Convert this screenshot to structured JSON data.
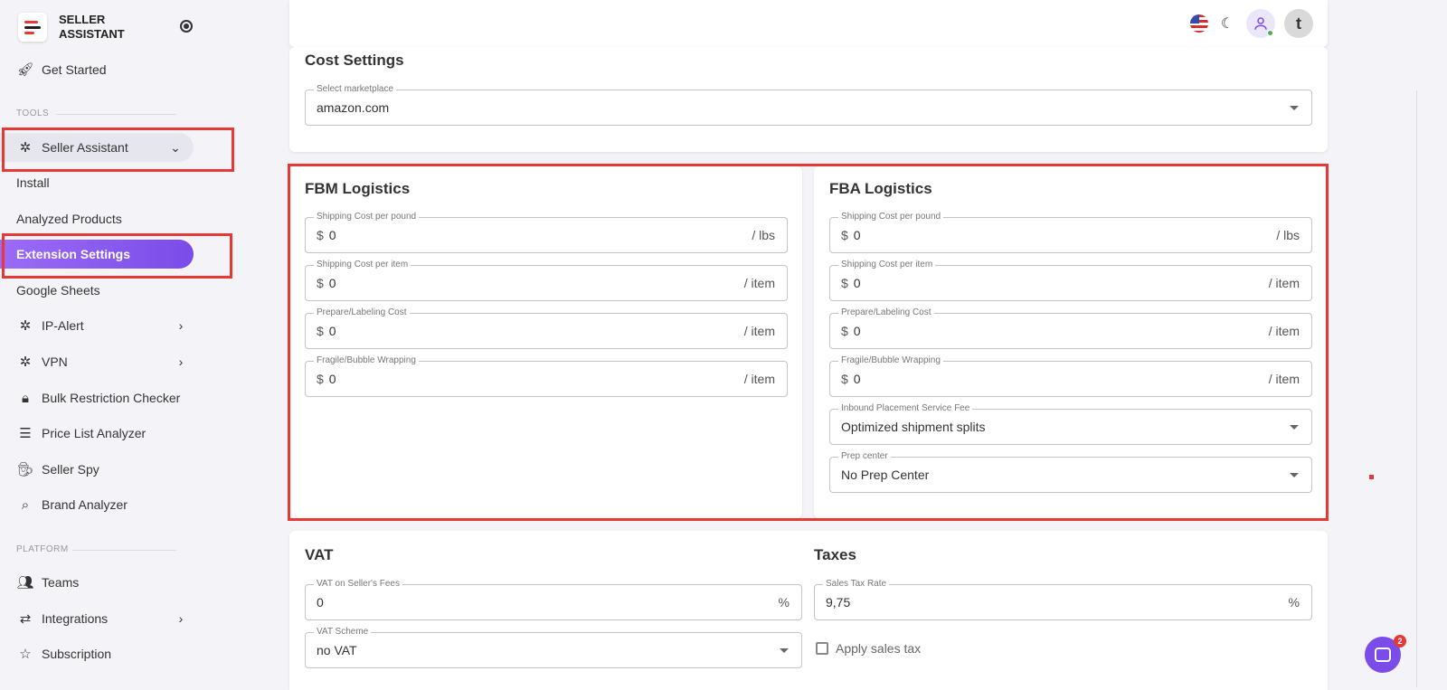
{
  "sidebar": {
    "brand": "SELLER ASSISTANT",
    "get_started": "Get Started",
    "tools_label": "TOOLS",
    "seller_assistant": "Seller Assistant",
    "install": "Install",
    "analyzed_products": "Analyzed Products",
    "extension_settings": "Extension Settings",
    "google_sheets": "Google Sheets",
    "ip_alert": "IP-Alert",
    "vpn": "VPN",
    "bulk_restriction": "Bulk Restriction Checker",
    "price_list": "Price List Analyzer",
    "seller_spy": "Seller Spy",
    "brand_analyzer": "Brand Analyzer",
    "platform_label": "PLATFORM",
    "teams": "Teams",
    "integrations": "Integrations",
    "subscription": "Subscription"
  },
  "topbar": {
    "avatar_letter": "t",
    "icons": [
      "us-flag-icon",
      "moon-icon",
      "user-icon"
    ]
  },
  "cost_settings": {
    "title": "Cost Settings",
    "marketplace_label": "Select marketplace",
    "marketplace_value": "amazon.com"
  },
  "fbm": {
    "title": "FBM Logistics",
    "currency": "$",
    "fields": [
      {
        "label": "Shipping Cost per pound",
        "value": "0",
        "unit": "/ lbs"
      },
      {
        "label": "Shipping Cost per item",
        "value": "0",
        "unit": "/ item"
      },
      {
        "label": "Prepare/Labeling Cost",
        "value": "0",
        "unit": "/ item"
      },
      {
        "label": "Fragile/Bubble Wrapping",
        "value": "0",
        "unit": "/ item"
      }
    ]
  },
  "fba": {
    "title": "FBA Logistics",
    "currency": "$",
    "fields": [
      {
        "label": "Shipping Cost per pound",
        "value": "0",
        "unit": "/ lbs"
      },
      {
        "label": "Shipping Cost per item",
        "value": "0",
        "unit": "/ item"
      },
      {
        "label": "Prepare/Labeling Cost",
        "value": "0",
        "unit": "/ item"
      },
      {
        "label": "Fragile/Bubble Wrapping",
        "value": "0",
        "unit": "/ item"
      }
    ],
    "inbound_label": "Inbound Placement Service Fee",
    "inbound_value": "Optimized shipment splits",
    "prep_label": "Prep center",
    "prep_value": "No Prep Center"
  },
  "vat": {
    "title": "VAT",
    "fees_label": "VAT on Seller's Fees",
    "fees_value": "0",
    "fees_unit": "%",
    "scheme_label": "VAT Scheme",
    "scheme_value": "no VAT"
  },
  "taxes": {
    "title": "Taxes",
    "rate_label": "Sales Tax Rate",
    "rate_value": "9,75",
    "rate_unit": "%",
    "apply_label": "Apply sales tax"
  },
  "chat": {
    "badge": "2"
  },
  "colors": {
    "accent": "#7b4ce8",
    "highlight": "#e53935"
  }
}
